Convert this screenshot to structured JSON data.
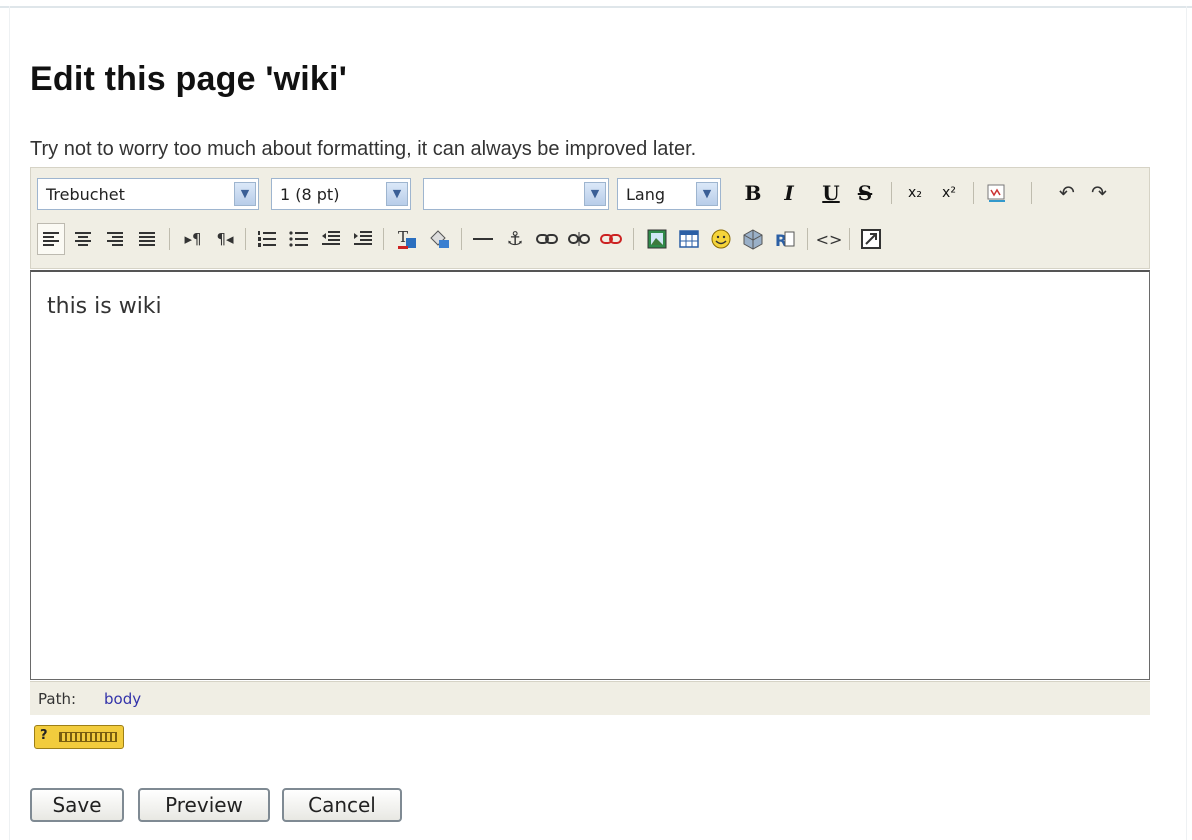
{
  "page": {
    "title": "Edit this page 'wiki'",
    "hint": "Try not to worry too much about formatting, it can always be improved later."
  },
  "toolbar": {
    "font_family": "Trebuchet",
    "font_size": "1 (8 pt)",
    "format": "",
    "lang": "Lang",
    "bold": "B",
    "italic": "I",
    "underline": "U",
    "strike": "S",
    "subscript": "x₂",
    "superscript": "x²",
    "icons_row1": [
      "font-family-select",
      "font-size-select",
      "format-select",
      "lang-select",
      "bold-icon",
      "italic-icon",
      "underline-icon",
      "strikethrough-icon",
      "subscript-icon",
      "superscript-icon",
      "spellcheck-icon",
      "undo-icon",
      "redo-icon"
    ],
    "icons_row2": [
      "align-left-icon",
      "align-center-icon",
      "align-right-icon",
      "align-justify-icon",
      "ltr-icon",
      "rtl-icon",
      "ordered-list-icon",
      "unordered-list-icon",
      "outdent-icon",
      "indent-icon",
      "text-color-icon",
      "background-color-icon",
      "horizontal-rule-icon",
      "anchor-icon",
      "link-icon",
      "unlink-icon",
      "page-link-icon",
      "image-icon",
      "table-icon",
      "emoticon-icon",
      "media-icon",
      "replace-icon",
      "html-source-icon",
      "fullscreen-icon"
    ]
  },
  "editor": {
    "content": "this is wiki"
  },
  "statusbar": {
    "path_label": "Path:",
    "path_value": "body"
  },
  "buttons": {
    "save": "Save",
    "preview": "Preview",
    "cancel": "Cancel"
  },
  "colors": {
    "toolbar_bg": "#f0eee4",
    "link": "#3333aa",
    "keyboard_badge": "#f2cc3d"
  }
}
